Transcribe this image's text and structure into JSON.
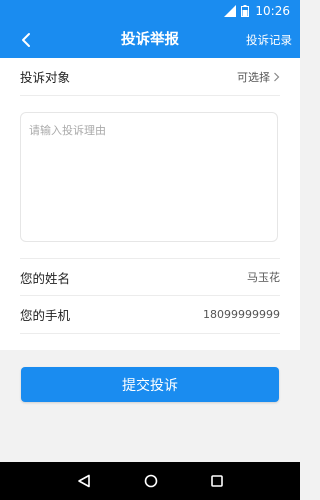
{
  "status_bar": {
    "time": "10:26"
  },
  "nav": {
    "title": "投诉举报",
    "right_link": "投诉记录"
  },
  "form": {
    "target_label": "投诉对象",
    "target_value": "可选择",
    "reason_placeholder": "请输入投诉理由",
    "name_label": "您的姓名",
    "name_value": "马玉花",
    "phone_label": "您的手机",
    "phone_value": "18099999999"
  },
  "submit_label": "提交投诉",
  "colors": {
    "accent": "#1a8cf0",
    "page_bg": "#f2f2f2"
  },
  "icons": [
    "signal-icon",
    "battery-icon",
    "back-arrow-icon",
    "chevron-right-icon",
    "nav-back-triangle-icon",
    "home-circle-icon",
    "recents-square-icon"
  ]
}
